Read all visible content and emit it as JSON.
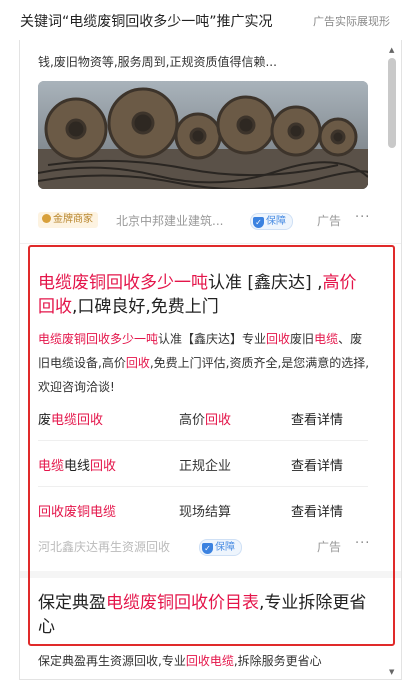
{
  "header": {
    "keyword_line": "关键词“电缆废铜回收多少一吨”推广实况",
    "note": "广告实际展现形"
  },
  "card1": {
    "snippet": "钱,废旧物资等,服务周到,正规资质值得信赖...",
    "badge": "金牌商家",
    "source": "北京中邦建业建筑...",
    "verified": "保障",
    "ad_label": "广告",
    "more": "···"
  },
  "ad": {
    "title_segments": [
      {
        "text": "电缆废铜回收多少一吨",
        "hl": true
      },
      {
        "text": "认准 [鑫庆达] ,",
        "hl": false
      },
      {
        "text": "高价回收",
        "hl": true
      },
      {
        "text": ",口碑良好,免费上门",
        "hl": false
      }
    ],
    "desc_segments": [
      {
        "text": "电缆废铜回收多少一吨",
        "hl": true
      },
      {
        "text": "认准【鑫庆达】专业",
        "hl": false
      },
      {
        "text": "回收",
        "hl": true
      },
      {
        "text": "废旧",
        "hl": false
      },
      {
        "text": "电缆",
        "hl": true
      },
      {
        "text": "、废旧电缆设备,高价",
        "hl": false
      },
      {
        "text": "回收",
        "hl": true
      },
      {
        "text": ",免费上门评估,资质齐全,是您满意的选择,欢迎咨询洽谈!",
        "hl": false
      }
    ],
    "sitelinks": [
      {
        "col1": [
          {
            "text": "废",
            "hl": false
          },
          {
            "text": "电缆回收",
            "hl": true
          }
        ],
        "col2": [
          {
            "text": "高价",
            "hl": false
          },
          {
            "text": "回收",
            "hl": true
          }
        ],
        "col3": "查看详情"
      },
      {
        "col1": [
          {
            "text": "电缆",
            "hl": true
          },
          {
            "text": "电线",
            "hl": false
          },
          {
            "text": "回收",
            "hl": true
          }
        ],
        "col2": [
          {
            "text": "正规企业",
            "hl": false
          }
        ],
        "col3": "查看详情"
      },
      {
        "col1": [
          {
            "text": "回收废铜电缆",
            "hl": true
          }
        ],
        "col2": [
          {
            "text": "现场结算",
            "hl": false
          }
        ],
        "col3": "查看详情"
      }
    ],
    "source": "河北鑫庆达再生资源回收",
    "verified": "保障",
    "ad_label": "广告",
    "more": "···"
  },
  "ad2": {
    "title_segments": [
      {
        "text": "保定典盈",
        "hl": false
      },
      {
        "text": "电缆废铜回收价目表",
        "hl": true
      },
      {
        "text": ",专业拆除更省心",
        "hl": false
      }
    ],
    "peek_segments": [
      {
        "text": "保定典盈再生资源回收,专业",
        "hl": false
      },
      {
        "text": "回收",
        "hl": true
      },
      {
        "text": "电缆",
        "hl": true
      },
      {
        "text": ",拆除服务更省心",
        "hl": false
      }
    ]
  },
  "colors": {
    "highlight": "#e4154a",
    "annotation_box": "#e02a2a",
    "verified_blue": "#3b82e0",
    "gold_badge": "#b8862d"
  },
  "icons": [
    "medal-icon",
    "shield-check-icon",
    "more-dots-icon",
    "scroll-up-icon",
    "scroll-down-icon"
  ]
}
